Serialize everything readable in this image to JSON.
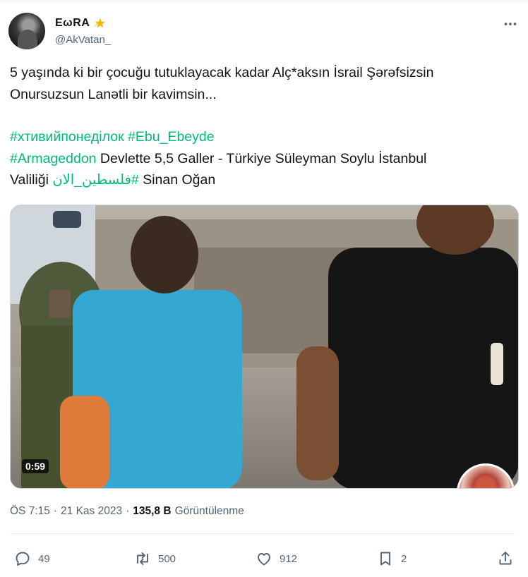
{
  "user": {
    "display_name": "EωRA",
    "handle": "@AkVatan_"
  },
  "tweet": {
    "text_line_1": "5 yaşında ki bir çocuğu tutuklayacak kadar Alç*aksın İsrail Şərəfsizsin",
    "text_line_2": "Onursuzsun Lanətli bir kavimsin...",
    "hashtag_1": "#хтивийпонеділок",
    "hashtag_2": "#Ebu_Ebeyde",
    "hashtag_3": "#Armageddon",
    "plain_1": " Devlette 5,5 Galler - Türkiye Süleyman Soylu İstanbul",
    "plain_2": "Valiliği ",
    "hashtag_4": "#فلسطين_الان",
    "plain_3": " Sinan Oğan"
  },
  "media": {
    "duration": "0:59"
  },
  "meta": {
    "time": "ÖS 7:15",
    "separator": "·",
    "date": "21 Kas 2023",
    "views_count": "135,8 B",
    "views_label": "Görüntülenme"
  },
  "actions": {
    "replies": "49",
    "reposts": "500",
    "likes": "912",
    "bookmarks": "2"
  },
  "colors": {
    "hashtag_blue": "#1d9bf0",
    "hashtag_green": "#00ba7c",
    "secondary_text": "#536471"
  },
  "icons": [
    "star-icon",
    "more-icon",
    "reply-icon",
    "repost-icon",
    "like-icon",
    "bookmark-icon",
    "share-icon"
  ]
}
